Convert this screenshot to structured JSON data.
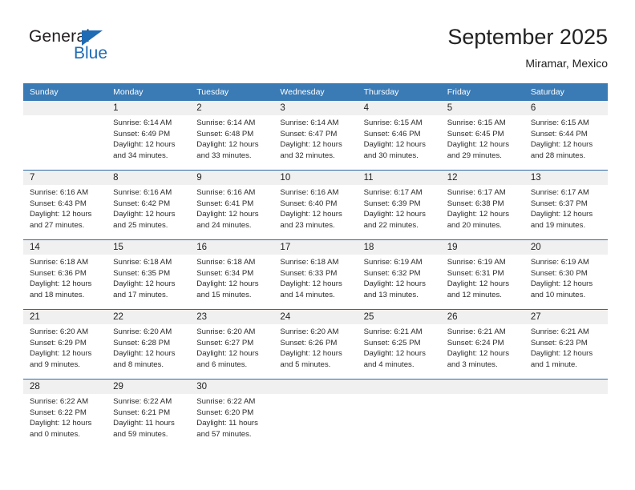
{
  "brand": {
    "name_part1": "General",
    "name_part2": "Blue",
    "triangle_color": "#1f6cb4"
  },
  "header": {
    "title": "September 2025",
    "subtitle": "Miramar, Mexico"
  },
  "theme": {
    "header_bar": "#3a7ab5",
    "row_divider": "#2f6ca8",
    "day_band": "#f0f0f0",
    "text": "#222222"
  },
  "calendar": {
    "weekday_headers": [
      "Sunday",
      "Monday",
      "Tuesday",
      "Wednesday",
      "Thursday",
      "Friday",
      "Saturday"
    ],
    "weeks": [
      [
        {
          "day": "",
          "sunrise": "",
          "sunset": "",
          "daylight_line1": "",
          "daylight_line2": ""
        },
        {
          "day": "1",
          "sunrise": "Sunrise: 6:14 AM",
          "sunset": "Sunset: 6:49 PM",
          "daylight_line1": "Daylight: 12 hours",
          "daylight_line2": "and 34 minutes."
        },
        {
          "day": "2",
          "sunrise": "Sunrise: 6:14 AM",
          "sunset": "Sunset: 6:48 PM",
          "daylight_line1": "Daylight: 12 hours",
          "daylight_line2": "and 33 minutes."
        },
        {
          "day": "3",
          "sunrise": "Sunrise: 6:14 AM",
          "sunset": "Sunset: 6:47 PM",
          "daylight_line1": "Daylight: 12 hours",
          "daylight_line2": "and 32 minutes."
        },
        {
          "day": "4",
          "sunrise": "Sunrise: 6:15 AM",
          "sunset": "Sunset: 6:46 PM",
          "daylight_line1": "Daylight: 12 hours",
          "daylight_line2": "and 30 minutes."
        },
        {
          "day": "5",
          "sunrise": "Sunrise: 6:15 AM",
          "sunset": "Sunset: 6:45 PM",
          "daylight_line1": "Daylight: 12 hours",
          "daylight_line2": "and 29 minutes."
        },
        {
          "day": "6",
          "sunrise": "Sunrise: 6:15 AM",
          "sunset": "Sunset: 6:44 PM",
          "daylight_line1": "Daylight: 12 hours",
          "daylight_line2": "and 28 minutes."
        }
      ],
      [
        {
          "day": "7",
          "sunrise": "Sunrise: 6:16 AM",
          "sunset": "Sunset: 6:43 PM",
          "daylight_line1": "Daylight: 12 hours",
          "daylight_line2": "and 27 minutes."
        },
        {
          "day": "8",
          "sunrise": "Sunrise: 6:16 AM",
          "sunset": "Sunset: 6:42 PM",
          "daylight_line1": "Daylight: 12 hours",
          "daylight_line2": "and 25 minutes."
        },
        {
          "day": "9",
          "sunrise": "Sunrise: 6:16 AM",
          "sunset": "Sunset: 6:41 PM",
          "daylight_line1": "Daylight: 12 hours",
          "daylight_line2": "and 24 minutes."
        },
        {
          "day": "10",
          "sunrise": "Sunrise: 6:16 AM",
          "sunset": "Sunset: 6:40 PM",
          "daylight_line1": "Daylight: 12 hours",
          "daylight_line2": "and 23 minutes."
        },
        {
          "day": "11",
          "sunrise": "Sunrise: 6:17 AM",
          "sunset": "Sunset: 6:39 PM",
          "daylight_line1": "Daylight: 12 hours",
          "daylight_line2": "and 22 minutes."
        },
        {
          "day": "12",
          "sunrise": "Sunrise: 6:17 AM",
          "sunset": "Sunset: 6:38 PM",
          "daylight_line1": "Daylight: 12 hours",
          "daylight_line2": "and 20 minutes."
        },
        {
          "day": "13",
          "sunrise": "Sunrise: 6:17 AM",
          "sunset": "Sunset: 6:37 PM",
          "daylight_line1": "Daylight: 12 hours",
          "daylight_line2": "and 19 minutes."
        }
      ],
      [
        {
          "day": "14",
          "sunrise": "Sunrise: 6:18 AM",
          "sunset": "Sunset: 6:36 PM",
          "daylight_line1": "Daylight: 12 hours",
          "daylight_line2": "and 18 minutes."
        },
        {
          "day": "15",
          "sunrise": "Sunrise: 6:18 AM",
          "sunset": "Sunset: 6:35 PM",
          "daylight_line1": "Daylight: 12 hours",
          "daylight_line2": "and 17 minutes."
        },
        {
          "day": "16",
          "sunrise": "Sunrise: 6:18 AM",
          "sunset": "Sunset: 6:34 PM",
          "daylight_line1": "Daylight: 12 hours",
          "daylight_line2": "and 15 minutes."
        },
        {
          "day": "17",
          "sunrise": "Sunrise: 6:18 AM",
          "sunset": "Sunset: 6:33 PM",
          "daylight_line1": "Daylight: 12 hours",
          "daylight_line2": "and 14 minutes."
        },
        {
          "day": "18",
          "sunrise": "Sunrise: 6:19 AM",
          "sunset": "Sunset: 6:32 PM",
          "daylight_line1": "Daylight: 12 hours",
          "daylight_line2": "and 13 minutes."
        },
        {
          "day": "19",
          "sunrise": "Sunrise: 6:19 AM",
          "sunset": "Sunset: 6:31 PM",
          "daylight_line1": "Daylight: 12 hours",
          "daylight_line2": "and 12 minutes."
        },
        {
          "day": "20",
          "sunrise": "Sunrise: 6:19 AM",
          "sunset": "Sunset: 6:30 PM",
          "daylight_line1": "Daylight: 12 hours",
          "daylight_line2": "and 10 minutes."
        }
      ],
      [
        {
          "day": "21",
          "sunrise": "Sunrise: 6:20 AM",
          "sunset": "Sunset: 6:29 PM",
          "daylight_line1": "Daylight: 12 hours",
          "daylight_line2": "and 9 minutes."
        },
        {
          "day": "22",
          "sunrise": "Sunrise: 6:20 AM",
          "sunset": "Sunset: 6:28 PM",
          "daylight_line1": "Daylight: 12 hours",
          "daylight_line2": "and 8 minutes."
        },
        {
          "day": "23",
          "sunrise": "Sunrise: 6:20 AM",
          "sunset": "Sunset: 6:27 PM",
          "daylight_line1": "Daylight: 12 hours",
          "daylight_line2": "and 6 minutes."
        },
        {
          "day": "24",
          "sunrise": "Sunrise: 6:20 AM",
          "sunset": "Sunset: 6:26 PM",
          "daylight_line1": "Daylight: 12 hours",
          "daylight_line2": "and 5 minutes."
        },
        {
          "day": "25",
          "sunrise": "Sunrise: 6:21 AM",
          "sunset": "Sunset: 6:25 PM",
          "daylight_line1": "Daylight: 12 hours",
          "daylight_line2": "and 4 minutes."
        },
        {
          "day": "26",
          "sunrise": "Sunrise: 6:21 AM",
          "sunset": "Sunset: 6:24 PM",
          "daylight_line1": "Daylight: 12 hours",
          "daylight_line2": "and 3 minutes."
        },
        {
          "day": "27",
          "sunrise": "Sunrise: 6:21 AM",
          "sunset": "Sunset: 6:23 PM",
          "daylight_line1": "Daylight: 12 hours",
          "daylight_line2": "and 1 minute."
        }
      ],
      [
        {
          "day": "28",
          "sunrise": "Sunrise: 6:22 AM",
          "sunset": "Sunset: 6:22 PM",
          "daylight_line1": "Daylight: 12 hours",
          "daylight_line2": "and 0 minutes."
        },
        {
          "day": "29",
          "sunrise": "Sunrise: 6:22 AM",
          "sunset": "Sunset: 6:21 PM",
          "daylight_line1": "Daylight: 11 hours",
          "daylight_line2": "and 59 minutes."
        },
        {
          "day": "30",
          "sunrise": "Sunrise: 6:22 AM",
          "sunset": "Sunset: 6:20 PM",
          "daylight_line1": "Daylight: 11 hours",
          "daylight_line2": "and 57 minutes."
        },
        {
          "day": "",
          "sunrise": "",
          "sunset": "",
          "daylight_line1": "",
          "daylight_line2": ""
        },
        {
          "day": "",
          "sunrise": "",
          "sunset": "",
          "daylight_line1": "",
          "daylight_line2": ""
        },
        {
          "day": "",
          "sunrise": "",
          "sunset": "",
          "daylight_line1": "",
          "daylight_line2": ""
        },
        {
          "day": "",
          "sunrise": "",
          "sunset": "",
          "daylight_line1": "",
          "daylight_line2": ""
        }
      ]
    ]
  }
}
